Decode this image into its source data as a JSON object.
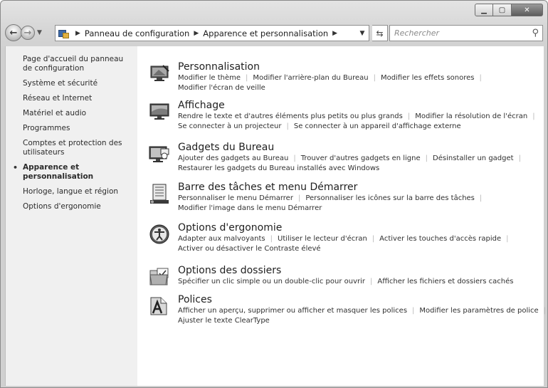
{
  "window": {
    "caption": {
      "minimize": "▁",
      "maximize": "▢",
      "close": "✕"
    }
  },
  "nav": {
    "breadcrumb": [
      "Panneau de configuration",
      "Apparence et personnalisation"
    ],
    "search_placeholder": "Rechercher"
  },
  "sidebar": {
    "items": [
      {
        "label": "Page d'accueil du panneau de configuration"
      },
      {
        "label": "Système et sécurité"
      },
      {
        "label": "Réseau et Internet"
      },
      {
        "label": "Matériel et audio"
      },
      {
        "label": "Programmes"
      },
      {
        "label": "Comptes et protection des utilisateurs"
      },
      {
        "label": "Apparence et personnalisation",
        "current": true
      },
      {
        "label": "Horloge, langue et région"
      },
      {
        "label": "Options d'ergonomie"
      }
    ]
  },
  "categories": [
    {
      "title": "Personnalisation",
      "icon": "personalization-icon",
      "lines": [
        [
          "Modifier le thème",
          "Modifier l'arrière-plan du Bureau",
          "Modifier les effets sonores"
        ],
        [
          "Modifier l'écran de veille"
        ]
      ]
    },
    {
      "title": "Affichage",
      "icon": "display-icon",
      "lines": [
        [
          "Rendre le texte et d'autres éléments plus petits ou plus grands",
          "Modifier la résolution de l'écran"
        ],
        [
          "Se connecter à un projecteur",
          "Se connecter à un appareil d'affichage externe"
        ]
      ]
    },
    {
      "title": "Gadgets du Bureau",
      "icon": "gadgets-icon",
      "lines": [
        [
          "Ajouter des gadgets au Bureau",
          "Trouver d'autres gadgets en ligne",
          "Désinstaller un gadget"
        ],
        [
          "Restaurer les gadgets du Bureau installés avec Windows"
        ]
      ]
    },
    {
      "title": "Barre des tâches et menu Démarrer",
      "icon": "taskbar-icon",
      "lines": [
        [
          "Personnaliser le menu Démarrer",
          "Personnaliser les icônes sur la barre des tâches"
        ],
        [
          "Modifier l'image dans le menu Démarrer"
        ]
      ]
    },
    {
      "title": "Options d'ergonomie",
      "icon": "ease-of-access-icon",
      "lines": [
        [
          "Adapter aux malvoyants",
          "Utiliser le lecteur d'écran",
          "Activer les touches d'accès rapide"
        ],
        [
          "Activer ou désactiver le Contraste élevé"
        ]
      ]
    },
    {
      "title": "Options des dossiers",
      "icon": "folder-options-icon",
      "lines": [
        [
          "Spécifier un clic simple ou un double-clic pour ouvrir",
          "Afficher les fichiers et dossiers cachés"
        ]
      ]
    },
    {
      "title": "Polices",
      "icon": "fonts-icon",
      "lines": [
        [
          "Afficher un aperçu, supprimer ou afficher et masquer les polices",
          "Modifier les paramètres de police"
        ],
        [
          "Ajuster le texte ClearType"
        ]
      ]
    }
  ]
}
